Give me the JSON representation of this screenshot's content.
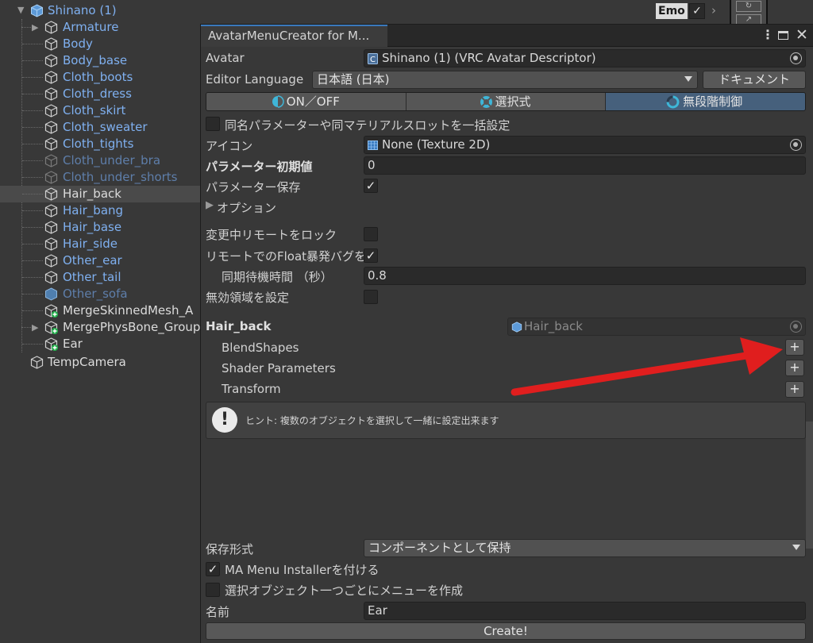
{
  "hierarchy": {
    "root": "Shinano (1)",
    "items": [
      {
        "label": "Armature"
      },
      {
        "label": "Body"
      },
      {
        "label": "Body_base"
      },
      {
        "label": "Cloth_boots"
      },
      {
        "label": "Cloth_dress"
      },
      {
        "label": "Cloth_skirt"
      },
      {
        "label": "Cloth_sweater"
      },
      {
        "label": "Cloth_tights"
      },
      {
        "label": "Cloth_under_bra"
      },
      {
        "label": "Cloth_under_shorts"
      },
      {
        "label": "Hair_back"
      },
      {
        "label": "Hair_bang"
      },
      {
        "label": "Hair_base"
      },
      {
        "label": "Hair_side"
      },
      {
        "label": "Other_ear"
      },
      {
        "label": "Other_tail"
      },
      {
        "label": "Other_sofa"
      },
      {
        "label": "MergeSkinnedMesh_A"
      },
      {
        "label": "MergePhysBone_Group"
      },
      {
        "label": "Ear"
      }
    ],
    "temp_camera": "TempCamera",
    "emo_badge": "Emo",
    "check_glyph": "✓"
  },
  "window": {
    "tab_title": "AvatarMenuCreator for M...",
    "avatar_label": "Avatar",
    "avatar_value": "Shinano (1) (VRC Avatar Descriptor)",
    "editor_language_label": "Editor Language",
    "editor_language_value": "日本語 (日本)",
    "doc_button": "ドキュメント",
    "modes": [
      "ON／OFF",
      "選択式",
      "無段階制御"
    ],
    "bulk_label": "同名パラメーターや同マテリアルスロットを一括設定",
    "icon_label": "アイコン",
    "icon_value": "None (Texture 2D)",
    "param_default_label": "パラメーター初期値",
    "param_default_value": "0",
    "param_save_label": "パラメーター保存",
    "options_label": "オプション",
    "lock_remote_label": "変更中リモートをロック",
    "float_bug_label": "リモートでのFloat暴発バグを防",
    "sync_wait_label": "同期待機時間 （秒）",
    "sync_wait_value": "0.8",
    "invalid_region_label": "無効領域を設定",
    "object_title": "Hair_back",
    "object_field": "Hair_back",
    "blendshapes_label": "BlendShapes",
    "shader_params_label": "Shader Parameters",
    "transform_label": "Transform",
    "hint_icon": "!",
    "hint_text": "ヒント: 複数のオブジェクトを選択して一緒に設定出来ます",
    "save_format_label": "保存形式",
    "save_format_value": "コンポーネントとして保持",
    "ma_installer_label": "MA Menu Installerを付ける",
    "per_object_label": "選択オブジェクト一つごとにメニューを作成",
    "name_label": "名前",
    "name_value": "Ear",
    "create_button": "Create!",
    "plus_glyph": "+",
    "check_glyph": "✓"
  },
  "colors": {
    "active_mode": "#46607c",
    "arrow": "#e01e1e",
    "hierarchy_blue": "#7fb0f0"
  }
}
